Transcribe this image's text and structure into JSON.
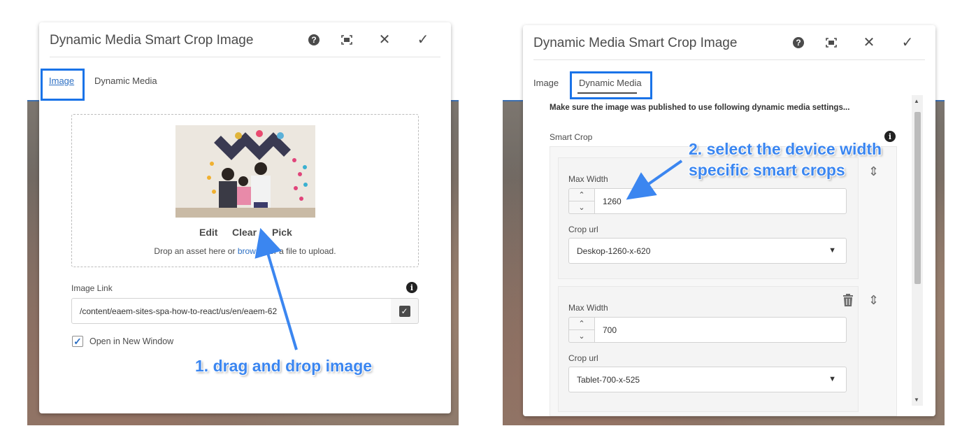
{
  "left_dialog": {
    "title": "Dynamic Media Smart Crop Image",
    "tabs": [
      "Image",
      "Dynamic Media"
    ],
    "actions": {
      "edit": "Edit",
      "clear": "Clear",
      "pick": "Pick"
    },
    "drop_text_before": "Drop an asset here or ",
    "drop_link": "browse",
    "drop_text_after": " for a file to upload.",
    "image_link_label": "Image Link",
    "image_link_value": "/content/eaem-sites-spa-how-to-react/us/en/eaem-62",
    "open_new_window_label": "Open in New Window"
  },
  "right_dialog": {
    "title": "Dynamic Media Smart Crop Image",
    "tabs": [
      "Image",
      "Dynamic Media"
    ],
    "notice": "Make sure the image was published to use following dynamic media settings...",
    "smart_crop_label": "Smart Crop",
    "items": [
      {
        "max_width_label": "Max Width",
        "max_width_value": "1260",
        "crop_url_label": "Crop url",
        "crop_url_value": "Deskop-1260-x-620"
      },
      {
        "max_width_label": "Max Width",
        "max_width_value": "700",
        "crop_url_label": "Crop url",
        "crop_url_value": "Tablet-700-x-525"
      }
    ]
  },
  "annotations": {
    "step1": "1. drag and drop image",
    "step2_line1": "2. select the device width",
    "step2_line2": "specific smart crops"
  },
  "icons": [
    "help-icon",
    "fullscreen-icon",
    "close-icon",
    "done-icon",
    "info-icon",
    "drag-icon",
    "delete-icon",
    "chevron-down-icon"
  ],
  "colors": {
    "accent": "#2c6fc3",
    "highlight": "#1a73e8",
    "annotation": "#3b86f0"
  }
}
